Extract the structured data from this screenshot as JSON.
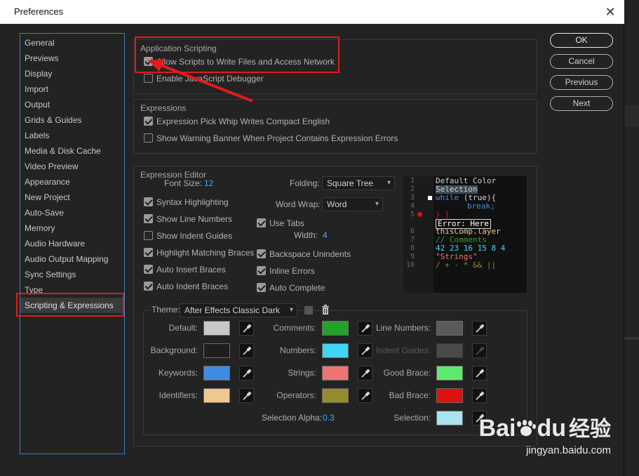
{
  "dialog": {
    "title": "Preferences",
    "close_glyph": "✕"
  },
  "sidebar": {
    "items": [
      {
        "label": "General"
      },
      {
        "label": "Previews"
      },
      {
        "label": "Display"
      },
      {
        "label": "Import"
      },
      {
        "label": "Output"
      },
      {
        "label": "Grids & Guides"
      },
      {
        "label": "Labels"
      },
      {
        "label": "Media & Disk Cache"
      },
      {
        "label": "Video Preview"
      },
      {
        "label": "Appearance"
      },
      {
        "label": "New Project"
      },
      {
        "label": "Auto-Save"
      },
      {
        "label": "Memory"
      },
      {
        "label": "Audio Hardware"
      },
      {
        "label": "Audio Output Mapping"
      },
      {
        "label": "Sync Settings"
      },
      {
        "label": "Type"
      },
      {
        "label": "Scripting & Expressions"
      }
    ],
    "selected": "Scripting & Expressions"
  },
  "buttons": {
    "ok": "OK",
    "cancel": "Cancel",
    "previous": "Previous",
    "next": "Next"
  },
  "app_scripting": {
    "title": "Application Scripting",
    "allow_scripts": {
      "label": "Allow Scripts to Write Files and Access Network",
      "checked": true
    },
    "enable_debugger": {
      "label": "Enable JavaScript Debugger",
      "checked": false
    }
  },
  "expressions": {
    "title": "Expressions",
    "pick_whip": {
      "label": "Expression Pick Whip Writes Compact English",
      "checked": true
    },
    "warning_banner": {
      "label": "Show Warning Banner When Project Contains Expression Errors",
      "checked": false
    }
  },
  "editor": {
    "title": "Expression Editor",
    "font_size_label": "Font Size:",
    "font_size_value": "12",
    "folding_label": "Folding:",
    "folding_value": "Square Tree",
    "word_wrap_label": "Word Wrap:",
    "word_wrap_value": "Word",
    "use_tabs": {
      "label": "Use Tabs",
      "checked": true
    },
    "width_label": "Width:",
    "width_value": "4",
    "syntax_highlighting": {
      "label": "Syntax Highlighting",
      "checked": true
    },
    "show_line_numbers": {
      "label": "Show Line Numbers",
      "checked": true
    },
    "show_indent_guides": {
      "label": "Show Indent Guides",
      "checked": false
    },
    "highlight_matching": {
      "label": "Highlight Matching Braces",
      "checked": true
    },
    "auto_insert": {
      "label": "Auto Insert Braces",
      "checked": true
    },
    "auto_indent": {
      "label": "Auto Indent Braces",
      "checked": true
    },
    "backspace_unindents": {
      "label": "Backspace Unindents",
      "checked": true
    },
    "inline_errors": {
      "label": "Inline Errors",
      "checked": true
    },
    "auto_complete": {
      "label": "Auto Complete",
      "checked": true
    }
  },
  "preview": {
    "line_numbers": [
      "1",
      "2",
      "3",
      "4",
      "5",
      "6",
      "7",
      "8",
      "9",
      "10"
    ],
    "lines": {
      "l1": "Default Color",
      "l2": "Selection",
      "l3a": "while",
      "l3b": " (true){",
      "l4": "break;",
      "l5": "} }",
      "err": "Error: Here",
      "l6": "thisComp.layer",
      "l7": "// Comments",
      "l8": "42 23 16 15 8 4",
      "l9": "\"Strings\"",
      "l10": "/ + - * && ||"
    }
  },
  "theme": {
    "label": "Theme:",
    "value": "After Effects Classic Dark",
    "selection_alpha_label": "Selection Alpha:",
    "selection_alpha_value": "0.3",
    "colors": {
      "default": {
        "label": "Default:",
        "color": "#c8c8c8"
      },
      "background": {
        "label": "Background:",
        "color": "#1e1e1e"
      },
      "keywords": {
        "label": "Keywords:",
        "color": "#3f8be3"
      },
      "identifiers": {
        "label": "Identifiers:",
        "color": "#eec98f"
      },
      "comments": {
        "label": "Comments:",
        "color": "#22a22a"
      },
      "numbers": {
        "label": "Numbers:",
        "color": "#3fd5f5"
      },
      "strings": {
        "label": "Strings:",
        "color": "#ef7373"
      },
      "operators": {
        "label": "Operators:",
        "color": "#938c2b"
      },
      "line_numbers": {
        "label": "Line Numbers:",
        "color": "#5a5a5a"
      },
      "indent_guides": {
        "label": "Indent Guides:",
        "color": "#4a4a4a"
      },
      "good_brace": {
        "label": "Good Brace:",
        "color": "#5deb6e"
      },
      "bad_brace": {
        "label": "Bad Brace:",
        "color": "#e01010"
      },
      "selection": {
        "label": "Selection:",
        "color": "#a8e3ef"
      }
    }
  },
  "watermark": {
    "brand": "Bai",
    "brand2": "du",
    "cn": "经验",
    "url": "jingyan.baidu.com"
  }
}
